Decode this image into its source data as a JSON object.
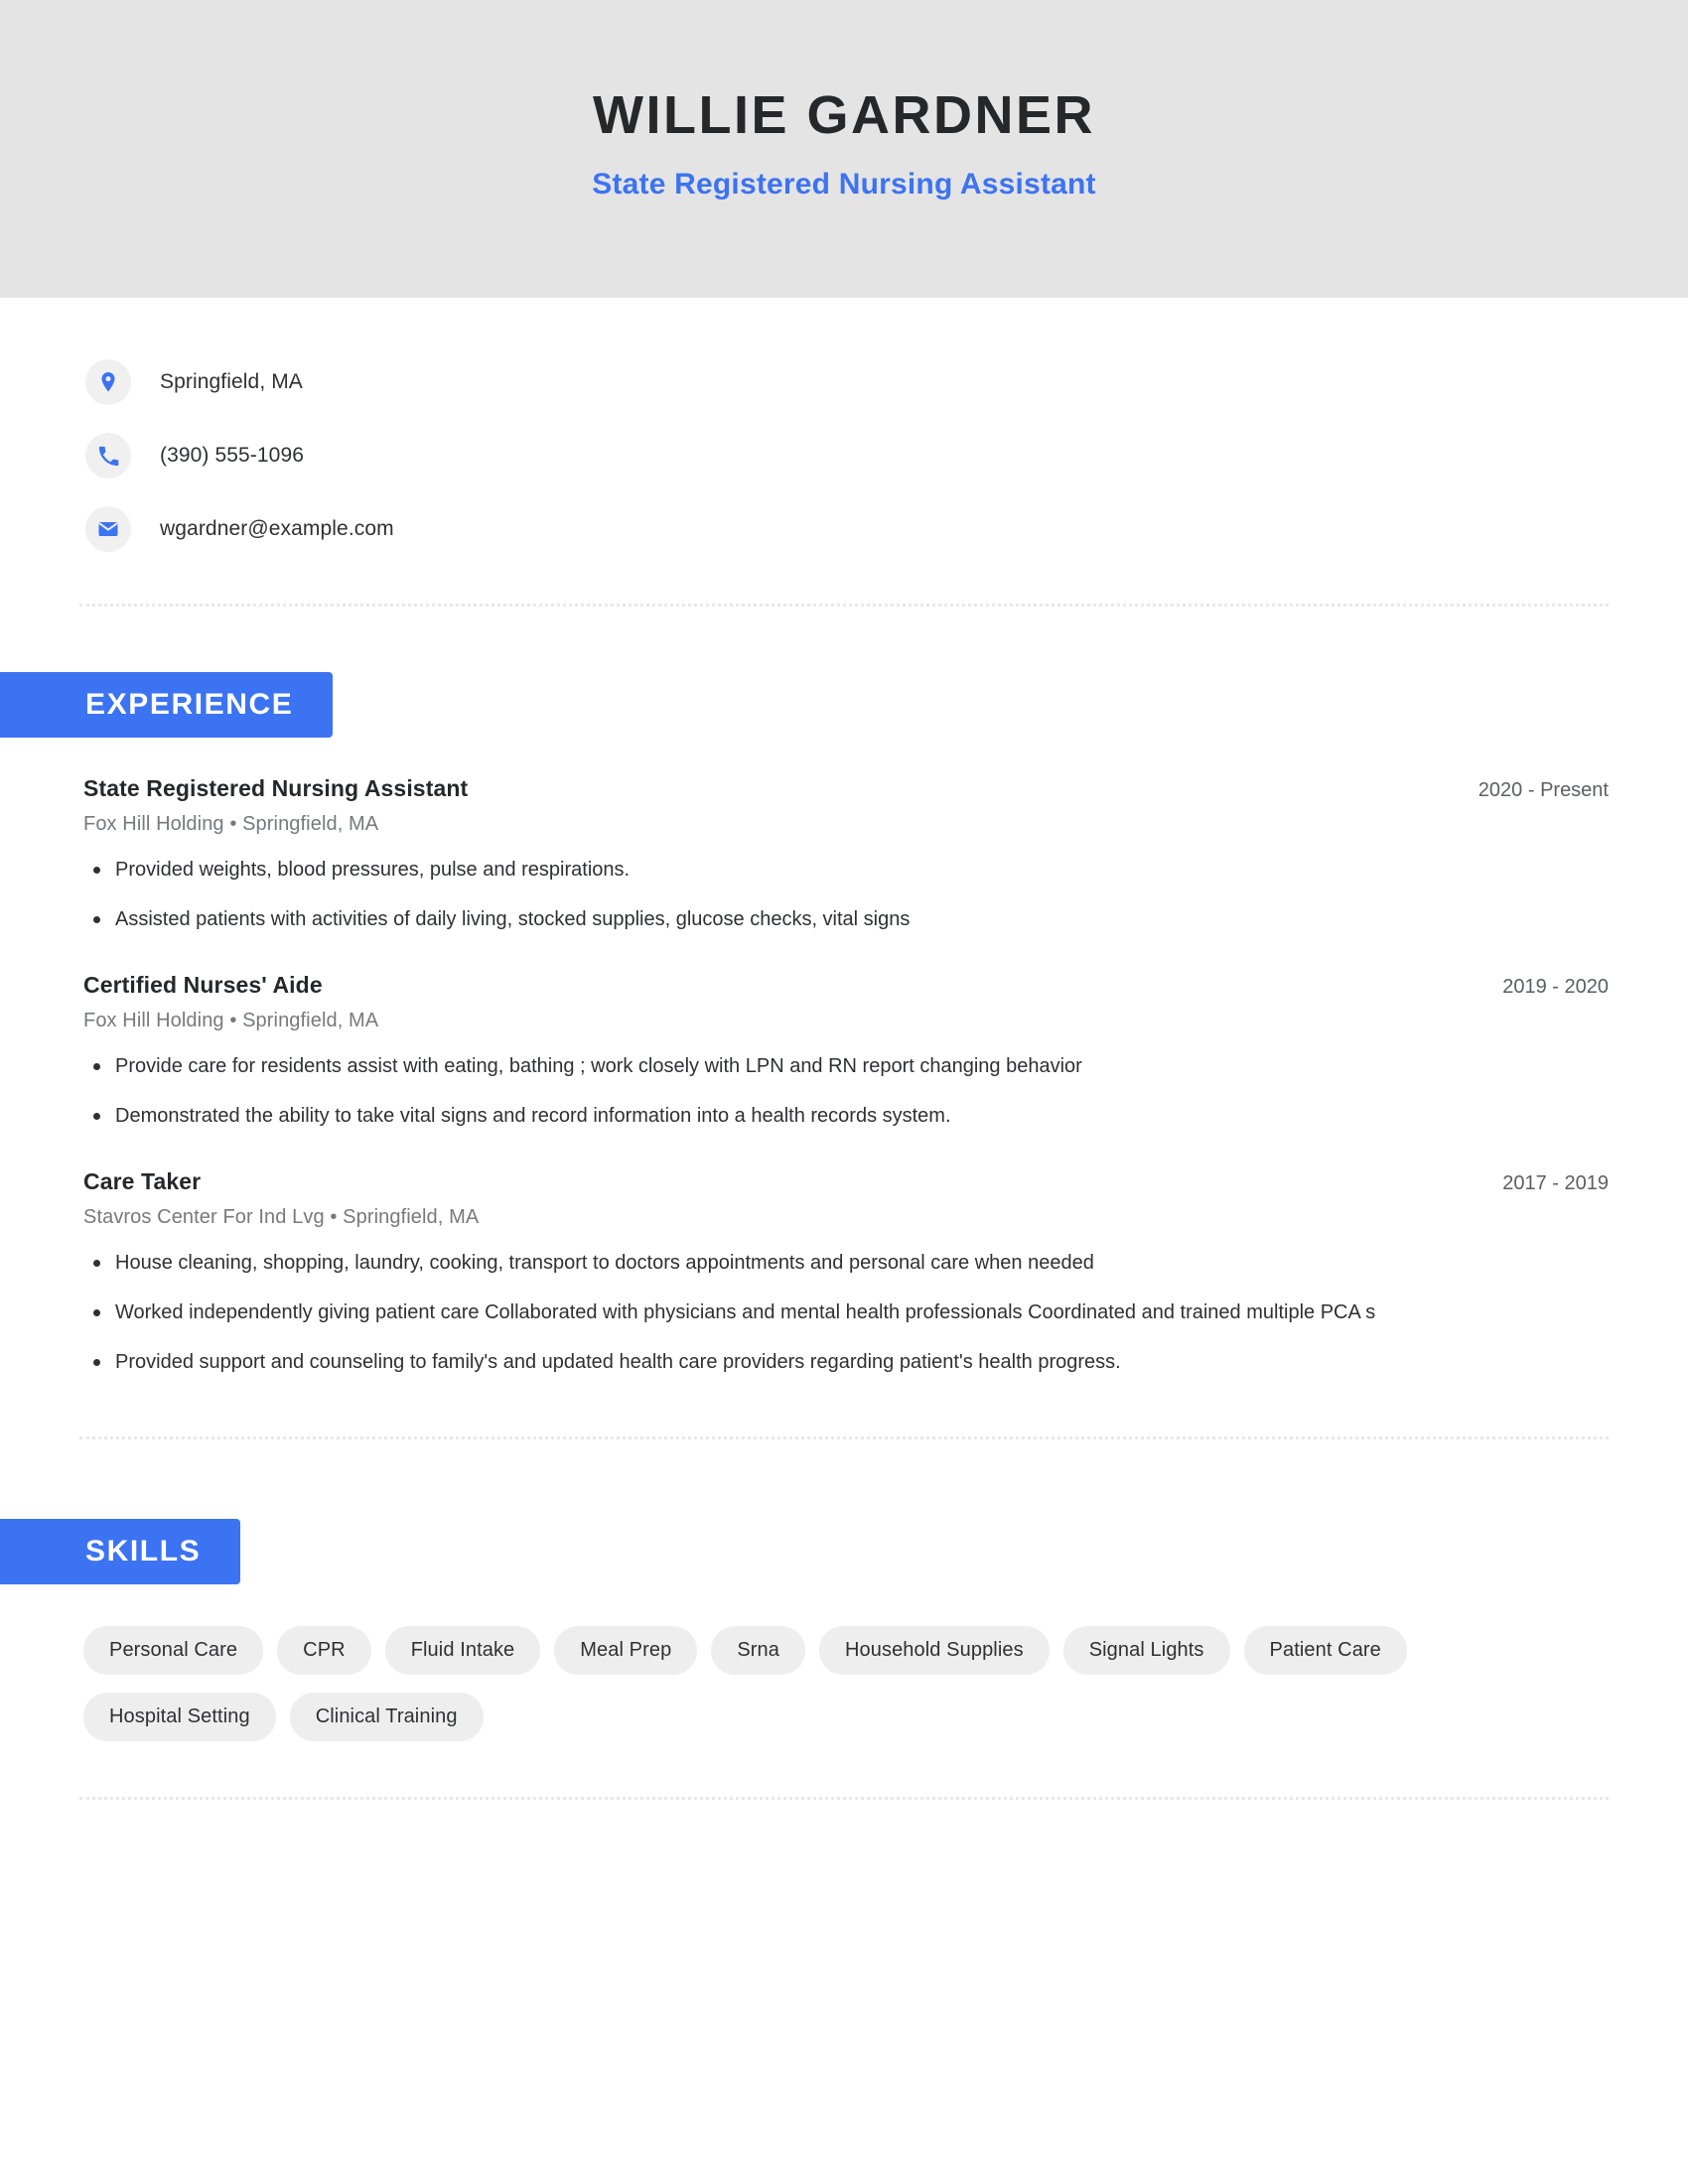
{
  "header": {
    "name": "WILLIE GARDNER",
    "title": "State Registered Nursing Assistant",
    "background_color": "#e4e4e4",
    "accent_color": "#3c73f2"
  },
  "contact": [
    {
      "icon": "location-pin-icon",
      "text": "Springfield, MA"
    },
    {
      "icon": "phone-icon",
      "text": "(390) 555-1096"
    },
    {
      "icon": "email-envelope-icon",
      "text": "wgardner@example.com"
    }
  ],
  "sections": {
    "experience": {
      "heading": "EXPERIENCE",
      "jobs": [
        {
          "title": "State Registered Nursing Assistant",
          "dates": "2020 - Present",
          "company": "Fox Hill Holding",
          "location": "Springfield, MA",
          "separator": "•",
          "bullets": [
            "Provided weights, blood pressures, pulse and respirations.",
            "Assisted patients with activities of daily living, stocked supplies, glucose checks, vital signs"
          ]
        },
        {
          "title": "Certified Nurses' Aide",
          "dates": "2019 - 2020",
          "company": "Fox Hill Holding",
          "location": "Springfield, MA",
          "separator": "•",
          "bullets": [
            "Provide care for residents assist with eating, bathing ; work closely with LPN and RN report changing behavior",
            "Demonstrated the ability to take vital signs and record information into a health records system."
          ]
        },
        {
          "title": "Care Taker",
          "dates": "2017 - 2019",
          "company": "Stavros Center For Ind Lvg",
          "location": "Springfield, MA",
          "separator": "•",
          "bullets": [
            "House cleaning, shopping, laundry, cooking, transport to doctors appointments and personal care when needed",
            "Worked independently giving patient care Collaborated with physicians and mental health professionals Coordinated and trained multiple PCA s",
            "Provided support and counseling to family's and updated health care providers regarding patient's health progress."
          ]
        }
      ]
    },
    "skills": {
      "heading": "SKILLS",
      "tags": [
        "Personal Care",
        "CPR",
        "Fluid Intake",
        "Meal Prep",
        "Srna",
        "Household Supplies",
        "Signal Lights",
        "Patient Care",
        "Hospital Setting",
        "Clinical Training"
      ]
    }
  }
}
